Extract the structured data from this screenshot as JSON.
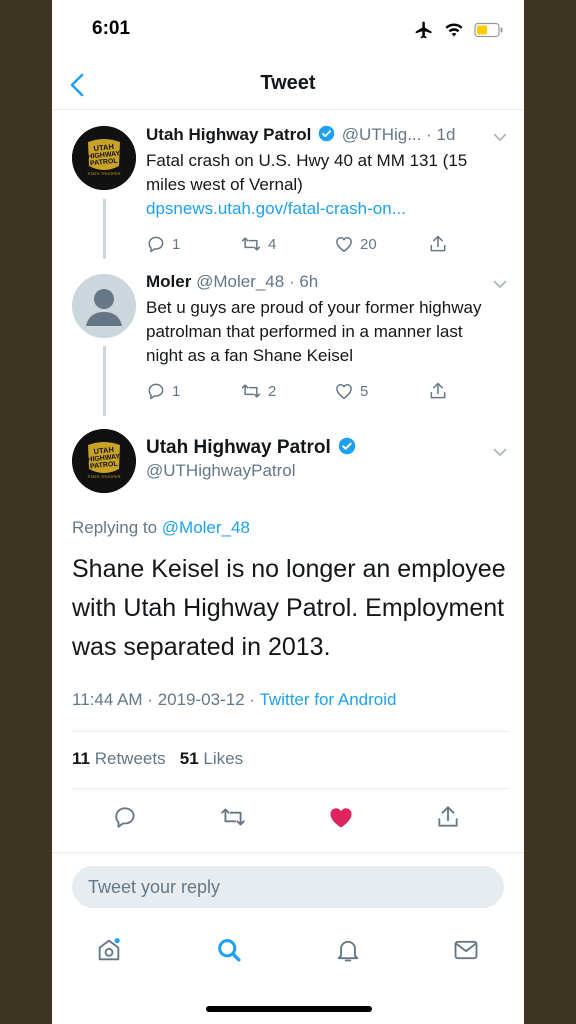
{
  "status_bar": {
    "time": "6:01"
  },
  "nav": {
    "title": "Tweet"
  },
  "tweet1": {
    "name": "Utah Highway Patrol",
    "handle": "@UTHig...",
    "time": "· 1d",
    "text": "Fatal crash on U.S. Hwy 40 at MM 131 (15 miles west of Vernal)",
    "link": "dpsnews.utah.gov/fatal-crash-on...",
    "replies": "1",
    "retweets": "4",
    "likes": "20",
    "avatar_lines": [
      "UTAH",
      "HIGHWAY",
      "PATROL"
    ],
    "avatar_tag": "STATE TROOPER"
  },
  "tweet2": {
    "name": "Moler",
    "handle": "@Moler_48",
    "time": "· 6h",
    "text": "Bet u guys are proud of your former highway patrolman that performed in a manner last night as a fan Shane Keisel",
    "replies": "1",
    "retweets": "2",
    "likes": "5"
  },
  "main_tweet": {
    "name": "Utah Highway Patrol",
    "handle": "@UTHighwayPatrol",
    "replying_prefix": "Replying to ",
    "replying_to": "@Moler_48",
    "text": "Shane Keisel is no longer an employee with Utah Highway Patrol. Employment was separated in 2013.",
    "time": "11:44 AM",
    "date": "2019-03-12",
    "source": "Twitter for Android",
    "retweets_count": "11",
    "retweets_label": "Retweets",
    "likes_count": "51",
    "likes_label": "Likes"
  },
  "reply_box": {
    "placeholder": "Tweet your reply"
  },
  "colors": {
    "accent": "#1da1f2",
    "like": "#e0245e",
    "muted": "#657786",
    "text": "#14171a"
  },
  "icons": [
    "back-icon",
    "airplane-icon",
    "wifi-icon",
    "battery-icon",
    "verified-icon",
    "chevron-down-icon",
    "reply-icon",
    "retweet-icon",
    "like-icon",
    "share-icon",
    "home-icon",
    "search-icon",
    "notifications-icon",
    "messages-icon"
  ]
}
